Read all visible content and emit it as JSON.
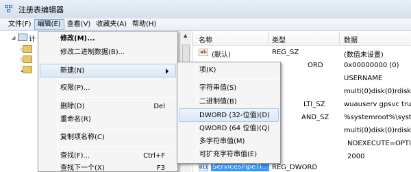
{
  "window": {
    "title": "注册表编辑器"
  },
  "menubar": [
    {
      "label": "文件(F)",
      "active": false
    },
    {
      "label": "编辑(E)",
      "active": true
    },
    {
      "label": "查看(V)",
      "active": false
    },
    {
      "label": "收藏夹(A)",
      "active": false
    },
    {
      "label": "帮助(H)",
      "active": false
    }
  ],
  "tree": {
    "root_label": "计"
  },
  "list": {
    "columns": {
      "name": "名称",
      "type": "类型",
      "data": "数据"
    },
    "rows": [
      {
        "name": "(默认)",
        "type": "REG_SZ",
        "data": "(数值未设置)",
        "icon": "ab"
      },
      {
        "name": "",
        "type": "ORD",
        "data": "0x00000000 (0)",
        "icon": ""
      },
      {
        "name": "",
        "type": "",
        "data": "USERNAME",
        "icon": ""
      },
      {
        "name": "",
        "type": "",
        "data": "multi(0)disk(0)rdisk",
        "icon": ""
      },
      {
        "name": "",
        "type": "LTI_SZ",
        "data": "wuauserv gpsvc tru",
        "icon": ""
      },
      {
        "name": "",
        "type": "AND_SZ",
        "data": "%systemroot%\\syst",
        "icon": ""
      },
      {
        "name": "",
        "type": "",
        "data": "multi(0)disk(0)rdisk",
        "icon": ""
      },
      {
        "name": "",
        "type": "",
        "data": "NOEXECUTE=OPTI",
        "icon": ""
      },
      {
        "name": "",
        "type": "",
        "data": "2000",
        "icon": ""
      },
      {
        "name": "ServicesPipeTi...",
        "type": "REG_DWORD",
        "data": "",
        "icon": "dw",
        "selected": true
      }
    ]
  },
  "edit_menu": {
    "items": [
      {
        "label": "修改(M)...",
        "bold": true
      },
      {
        "label": "修改二进制数据(B)..."
      },
      {
        "label": "新建(N)",
        "submenu": true,
        "highlight": true
      },
      {
        "label": "权限(P)..."
      },
      {
        "label": "删除(D)",
        "shortcut": "Del"
      },
      {
        "label": "重命名(R)"
      },
      {
        "label": "复制项名称(C)"
      },
      {
        "label": "查找(F)...",
        "shortcut": "Ctrl+F"
      },
      {
        "label": "查找下一个(X)",
        "shortcut": "F3"
      }
    ]
  },
  "new_submenu": {
    "items": [
      {
        "label": "项(K)"
      },
      {
        "label": "字符串值(S)"
      },
      {
        "label": "二进制值(B)"
      },
      {
        "label": "DWORD (32-位值)(D)",
        "highlight": true
      },
      {
        "label": "QWORD (64 位值)(Q)"
      },
      {
        "label": "多字符串值(M)"
      },
      {
        "label": "可扩充字符串值(E)"
      }
    ]
  }
}
